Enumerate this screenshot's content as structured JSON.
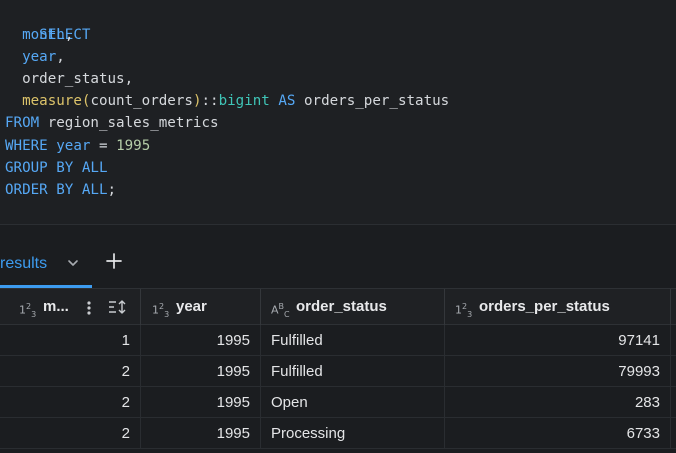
{
  "editor": {
    "sql": {
      "select": "SELECT",
      "col_month": "month",
      "comma": ",",
      "col_year": "year",
      "col_status": "order_status",
      "fn_measure": "measure",
      "paren_open": "(",
      "arg": "count_orders",
      "paren_close": ")",
      "cast_op": "::",
      "cast_type": "bigint",
      "as_kw": "AS",
      "alias": "orders_per_status",
      "from_kw": "FROM",
      "table": "region_sales_metrics",
      "where_kw": "WHERE",
      "where_col": "year",
      "eq": "=",
      "where_val": "1995",
      "group_kw": "GROUP BY ALL",
      "order_kw": "ORDER BY ALL",
      "semicolon": ";"
    }
  },
  "tabs": {
    "results_label": "results",
    "chevron_icon": "chevron-down-icon",
    "add_icon": "plus-icon"
  },
  "table": {
    "columns": [
      {
        "label": "m...",
        "type_icon": "numeric-type-icon",
        "type_text": "123"
      },
      {
        "label": "year",
        "type_icon": "numeric-type-icon",
        "type_text": "123"
      },
      {
        "label": "order_status",
        "type_icon": "text-type-icon",
        "type_text": "ABC"
      },
      {
        "label": "orders_per_status",
        "type_icon": "numeric-type-icon",
        "type_text": "123"
      }
    ],
    "rows": [
      [
        "1",
        "1995",
        "Fulfilled",
        "97141"
      ],
      [
        "2",
        "1995",
        "Fulfilled",
        "79993"
      ],
      [
        "2",
        "1995",
        "Open",
        "283"
      ],
      [
        "2",
        "1995",
        "Processing",
        "6733"
      ]
    ]
  },
  "colors": {
    "keyword": "#56a8f5",
    "function": "#dcc36a",
    "type": "#3fc5b7",
    "number": "#b5cea8",
    "accent": "#3d9cf0"
  }
}
